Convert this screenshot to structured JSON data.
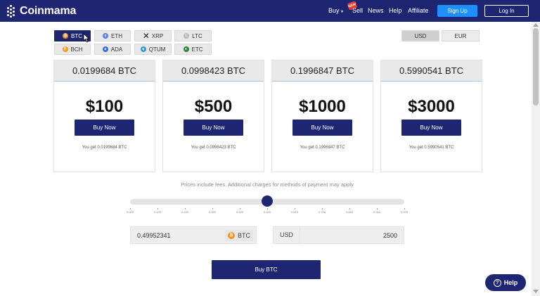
{
  "header": {
    "brand": "Coinmama",
    "nav": {
      "buy": "Buy",
      "sell": "Sell",
      "new_badge": "NEW",
      "news": "News",
      "help": "Help",
      "affiliate": "Affiliate"
    },
    "signup": "Sign Up",
    "login": "Log In"
  },
  "coins": [
    {
      "label": "BTC",
      "icon": "bitcoin-icon",
      "color": "#f7931a",
      "active": true
    },
    {
      "label": "ETH",
      "icon": "ethereum-icon",
      "color": "#627eea",
      "active": false
    },
    {
      "label": "XRP",
      "icon": "ripple-icon",
      "color": "#23292f",
      "active": false
    },
    {
      "label": "LTC",
      "icon": "litecoin-icon",
      "color": "#b8b8b8",
      "active": false
    },
    {
      "label": "BCH",
      "icon": "bitcoin-cash-icon",
      "color": "#f7931a",
      "active": false
    },
    {
      "label": "ADA",
      "icon": "cardano-icon",
      "color": "#2f6fd6",
      "active": false
    },
    {
      "label": "QTUM",
      "icon": "qtum-icon",
      "color": "#2e9ad0",
      "active": false
    },
    {
      "label": "ETC",
      "icon": "ethereum-classic-icon",
      "color": "#328332",
      "active": false
    }
  ],
  "currencies": [
    {
      "label": "USD",
      "active": true
    },
    {
      "label": "EUR",
      "active": false
    }
  ],
  "offers": [
    {
      "amount_crypto": "0.0199684 BTC",
      "price": "$100",
      "button": "Buy Now",
      "you_get": "You get 0.0199684 BTC"
    },
    {
      "amount_crypto": "0.0998423 BTC",
      "price": "$500",
      "button": "Buy Now",
      "you_get": "You get 0.0998423 BTC"
    },
    {
      "amount_crypto": "0.1996847 BTC",
      "price": "$1000",
      "button": "Buy Now",
      "you_get": "You get 0.1996847 BTC"
    },
    {
      "amount_crypto": "0.5990541 BTC",
      "price": "$3000",
      "button": "Buy Now",
      "you_get": "You get 0.5990541 BTC"
    }
  ],
  "fees_note": "Prices include fees. Additional charges for methods of payment may apply",
  "slider": {
    "value_fraction": 0.5,
    "ticks": [
      "0.020",
      "0.125",
      "0.220",
      "0.320",
      "0.420",
      "0.520",
      "0.619",
      "0.718",
      "0.818",
      "0.916",
      "0.976"
    ]
  },
  "converter": {
    "crypto_value": "0.49952341",
    "crypto_unit": "BTC",
    "fiat_unit": "USD",
    "fiat_value": "2500"
  },
  "buy_button": "Buy BTC",
  "help_button": "Help",
  "colors": {
    "brand_navy": "#1e2571",
    "signup_blue": "#1f8fff",
    "bitcoin_orange": "#f7931a"
  }
}
